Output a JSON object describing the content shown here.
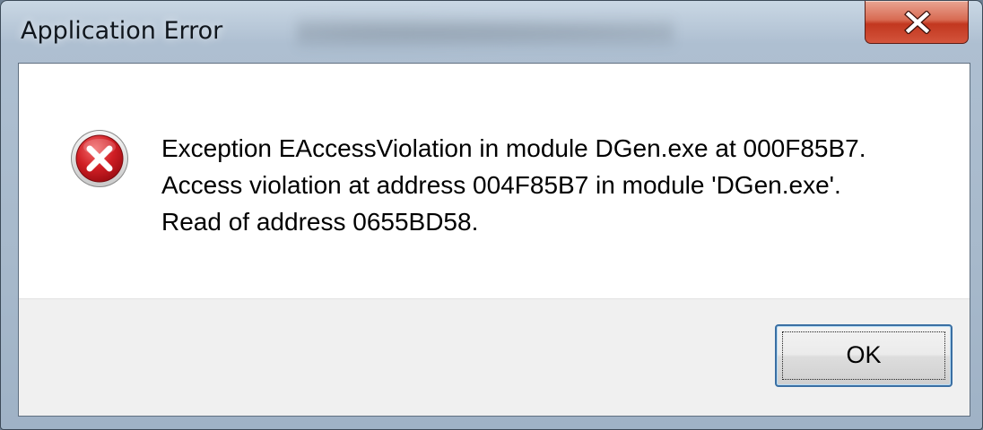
{
  "window": {
    "title": "Application Error",
    "close_icon": "close-x-icon"
  },
  "dialog": {
    "icon": "error-icon",
    "message_lines": [
      "Exception EAccessViolation in module DGen.exe at 000F85B7.",
      "Access violation at address 004F85B7 in module 'DGen.exe'.",
      "Read of address 0655BD58."
    ],
    "ok_label": "OK"
  },
  "colors": {
    "close_button": "#c7432b",
    "error_icon_red": "#c8141c",
    "footer_background": "#f0f0f0",
    "focus_border": "#3a6fa3"
  }
}
